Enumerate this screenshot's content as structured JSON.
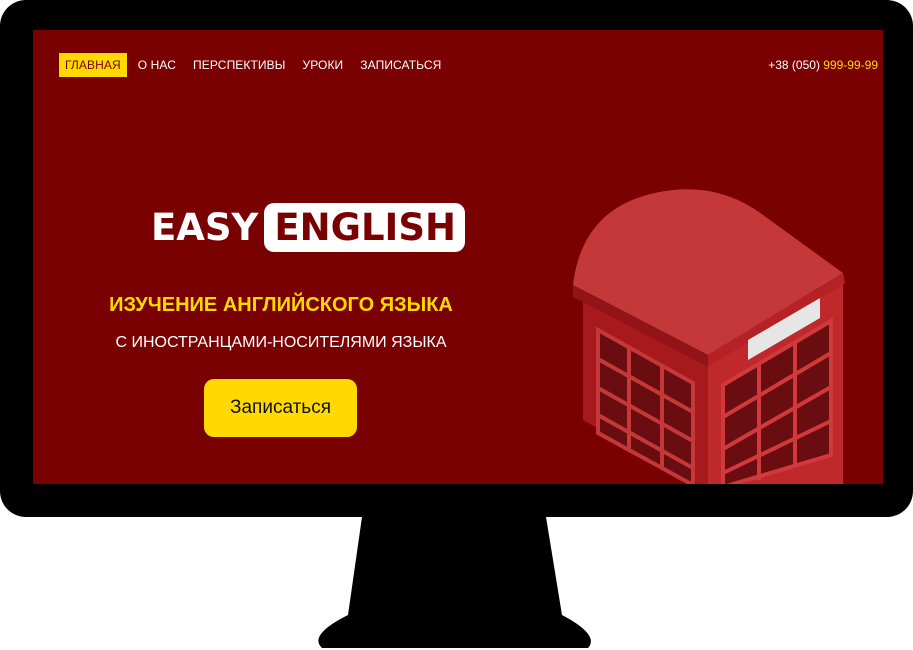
{
  "nav": {
    "items": [
      {
        "label": "ГЛАВНАЯ",
        "active": true
      },
      {
        "label": "О НАС",
        "active": false
      },
      {
        "label": "ПЕРСПЕКТИВЫ",
        "active": false
      },
      {
        "label": "УРОКИ",
        "active": false
      },
      {
        "label": "ЗАПИСАТЬСЯ",
        "active": false
      }
    ]
  },
  "phone": {
    "prefix": "+38 (050)",
    "number": "999-99-99"
  },
  "hero": {
    "logo_easy": "EASY",
    "logo_english": "ENGLISH",
    "headline": "ИЗУЧЕНИЕ АНГЛИЙСКОГО ЯЗЫКА",
    "subline": "С ИНОСТРАНЦАМИ-НОСИТЕЛЯМИ ЯЗЫКА",
    "cta_label": "Записаться"
  },
  "colors": {
    "background": "#7a0102",
    "accent": "#ffd900",
    "text": "#ffffff",
    "bezel": "#000000"
  },
  "icons": {
    "illustration": "phone-booth-illustration"
  }
}
